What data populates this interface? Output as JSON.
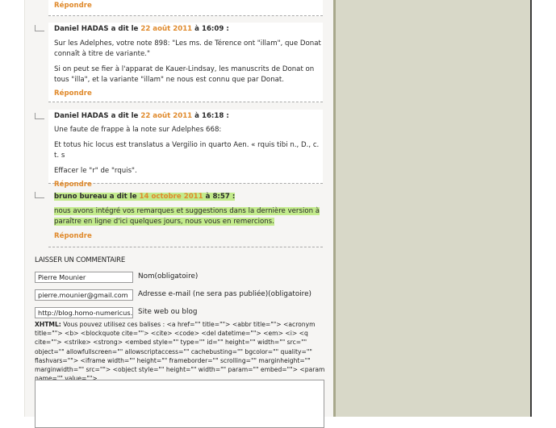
{
  "top_reply": "Répondre",
  "comments": [
    {
      "author": "Daniel HADAS",
      "says": "a dit le",
      "date": "22 août 2011",
      "at": "à",
      "time": "16:09 :",
      "paragraphs": [
        "Sur les Adelphes, votre note 898: \"Les ms. de Térence ont \"illam\", que Donat connaît à titre de variante.\"",
        "Si on peut se fier à l'apparat de Kauer-Lindsay, les manuscrits de Donat on tous \"illa\", et la variante \"illam\" ne nous est connu que par Donat."
      ],
      "reply": "Répondre"
    },
    {
      "author": "Daniel HADAS",
      "says": "a dit le",
      "date": "22 août 2011",
      "at": "à",
      "time": "16:18 :",
      "paragraphs": [
        "Une faute de frappe à la note sur Adelphes 668:",
        "Et totus hic locus est translatus a Vergilio in quarto Aen. « rquis tibi n., D., c. t. s",
        "Effacer le \"r\" de \"rquis\"."
      ],
      "reply": "Répondre"
    },
    {
      "author": "bruno bureau",
      "says": "a dit le",
      "date": "14 octobre 2011",
      "at": "à",
      "time": "8:57 :",
      "paragraphs": [
        "nous avons intégré vos remarques et suggestions dans la dernière version à paraître en ligne d'ici quelques jours, nous vous en remercions."
      ],
      "reply": "Répondre"
    }
  ],
  "form": {
    "section_title": "LAISSER UN COMMENTAIRE",
    "name_value": "Pierre Mounier",
    "name_label": "Nom(obligatoire)",
    "email_value": "pierre.mounier@gmail.com",
    "email_label": "Adresse e-mail (ne sera pas publiée)(obligatoire)",
    "site_value": "http://blog.homo-numericus.ne",
    "site_label": "Site web ou blog",
    "xhtml_prefix": "XHTML:",
    "xhtml_text": "Vous pouvez utilisez ces balises : <a href=\"\" title=\"\"> <abbr title=\"\"> <acronym title=\"\"> <b> <blockquote cite=\"\"> <cite> <code> <del datetime=\"\"> <em> <i> <q cite=\"\"> <strike> <strong> <embed style=\"\" type=\"\" id=\"\" height=\"\" width=\"\" src=\"\" object=\"\" allowfullscreen=\"\" allowscriptaccess=\"\" cachebusting=\"\" bgcolor=\"\" quality=\"\" flashvars=\"\"> <iframe width=\"\" height=\"\" frameborder=\"\" scrolling=\"\" marginheight=\"\" marginwidth=\"\" src=\"\"> <object style=\"\" height=\"\" width=\"\" param=\"\" embed=\"\"> <param name=\"\" value=\"\">"
  },
  "colors": {
    "accent": "#e08a2c",
    "highlight": "#c3eb8c",
    "sidebar": "#d8d8c8"
  }
}
